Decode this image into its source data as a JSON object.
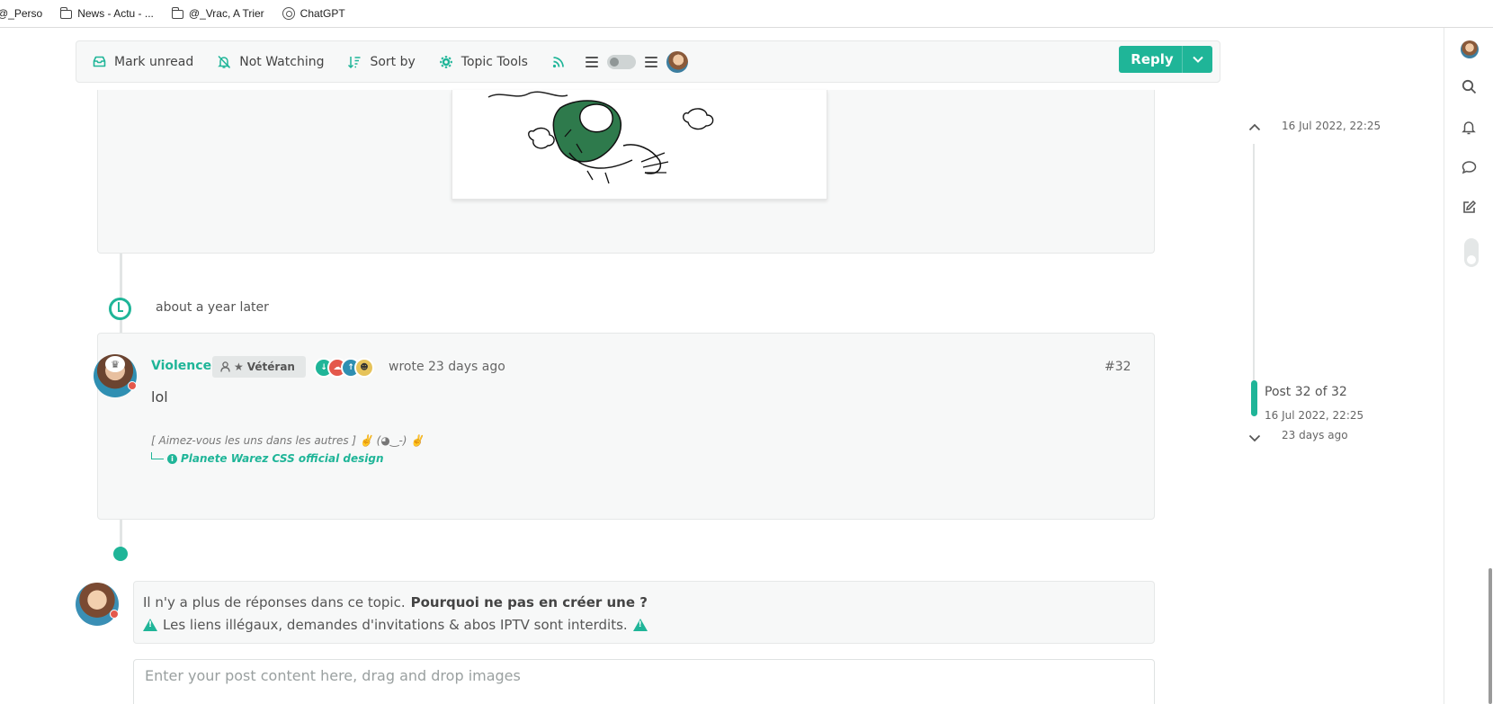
{
  "bookmarks": [
    {
      "label": "@_Perso",
      "icon": "folder-icon"
    },
    {
      "label": "News - Actu - ...",
      "icon": "folder-icon"
    },
    {
      "label": "@_Vrac, A Trier",
      "icon": "folder-icon"
    },
    {
      "label": "ChatGPT",
      "icon": "chatgpt-icon"
    }
  ],
  "toolbar": {
    "mark_unread": "Mark unread",
    "not_watching": "Not Watching",
    "sort_by": "Sort by",
    "topic_tools": "Topic Tools",
    "reply": "Reply"
  },
  "separator": {
    "label": "about a year later"
  },
  "post": {
    "author": "Violence",
    "rank": "Vétéran",
    "wrote": "wrote 23 days ago",
    "number": "#32",
    "content": "lol",
    "signature_quote": "[ Aimez-vous les uns dans les autres ] ✌️ (◕‿-) ✌️",
    "signature_link": "Planete Warez CSS official design"
  },
  "quick_reply": {
    "notice_text": "Il n'y a plus de réponses dans ce topic.",
    "notice_cta": "Pourquoi ne pas en créer une ?",
    "rules": "Les liens illégaux, demandes d'invitations & abos IPTV sont interdits.",
    "placeholder": "Enter your post content here, drag and drop images"
  },
  "timeline": {
    "first_date": "16 Jul 2022, 22:25",
    "current_post": "Post 32 of 32",
    "current_date": "16 Jul 2022, 22:25",
    "last_ago": "23 days ago"
  },
  "colors": {
    "accent": "#1fb598",
    "status_busy": "#e4584b"
  }
}
